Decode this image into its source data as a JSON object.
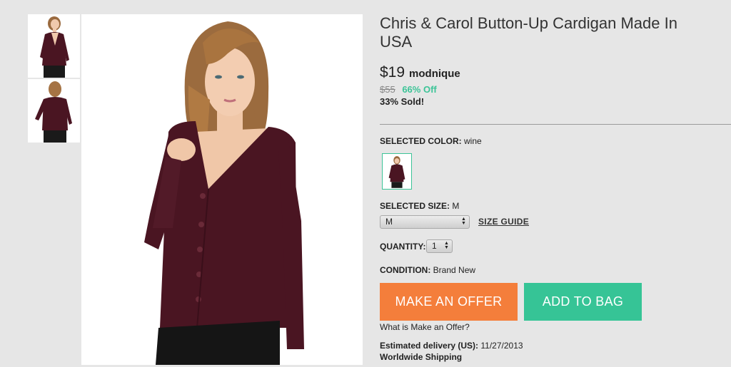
{
  "product": {
    "title": "Chris & Carol Button-Up Cardigan Made In USA",
    "price": "$19",
    "brand": "modnique",
    "original_price": "$55",
    "percent_off": "66% Off",
    "sold": "33% Sold!"
  },
  "color": {
    "label": "SELECTED COLOR:",
    "value": "wine"
  },
  "size": {
    "label": "SELECTED SIZE:",
    "value": "M",
    "select_value": "M",
    "guide_label": "SIZE GUIDE"
  },
  "quantity": {
    "label": "QUANTITY:",
    "value": "1"
  },
  "condition": {
    "label": "CONDITION:",
    "value": "Brand New"
  },
  "buttons": {
    "offer": "MAKE AN OFFER",
    "bag": "ADD TO BAG"
  },
  "offer_help": "What is Make an Offer?",
  "delivery": {
    "label": "Estimated delivery (US):",
    "date": "11/27/2013",
    "shipping": "Worldwide Shipping"
  },
  "colors": {
    "accent_green": "#36c496",
    "offer_orange": "#f47e3b",
    "garment_wine": "#4a1522"
  }
}
